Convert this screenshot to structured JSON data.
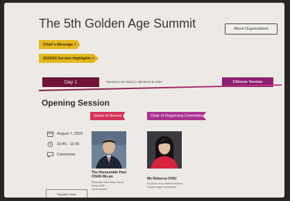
{
  "header": {
    "title": "The 5th Golden Age Summit",
    "about_button": "About Organizations"
  },
  "nav": {
    "chairs_message": "Chair's Message >",
    "service_highlights": "2019/20 Service Highlights >"
  },
  "day_tab": "Day 1",
  "day_note": "*Speakers are listed in alphabetical order",
  "chinese_button": "Chinese Version",
  "session": {
    "title": "Opening Session",
    "guest_tag": "Guest of Honour",
    "chair_tag": "Chair of Organising Committee",
    "date": "August 7, 2020",
    "time": "10:45 - 11:00",
    "language": "Cantonese"
  },
  "speakers": [
    {
      "name_line1": "The Honourable Paul",
      "name_line2": "CHAN Mo-po",
      "detail_line1": "Financial Secretary, Hong",
      "detail_line2": "Kong SAR",
      "detail_line3": "Government"
    },
    {
      "name_line1": "Ms Rebecca CHIU",
      "detail_line1": "Founder and Chief Executive",
      "detail_line2": "Golden Age Foundation"
    }
  ],
  "register_button": "Register Now",
  "colors": {
    "accent_yellow": "#e3b71e",
    "day_maroon": "#6e1438",
    "accent_magenta": "#8c1f72",
    "guest_tag": "#d43358",
    "chair_tag": "#a9338f"
  }
}
